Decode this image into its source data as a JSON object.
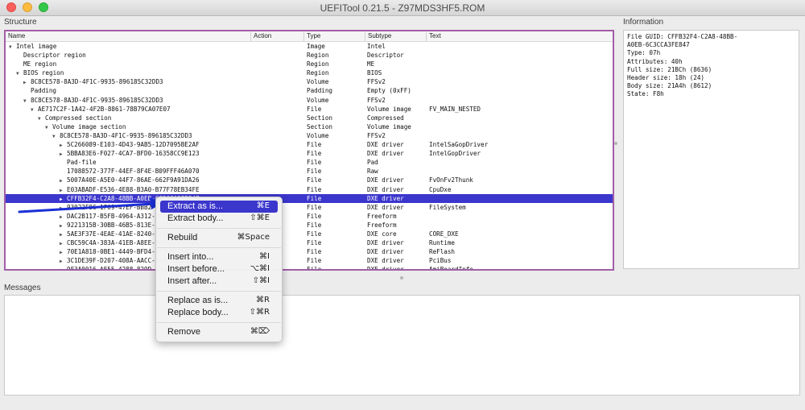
{
  "window": {
    "title": "UEFITool 0.21.5 - Z97MDS3HF5.ROM"
  },
  "panes": {
    "structure": "Structure",
    "information": "Information",
    "messages": "Messages"
  },
  "columns": {
    "name": "Name",
    "action": "Action",
    "type": "Type",
    "subtype": "Subtype",
    "text": "Text"
  },
  "rows": [
    {
      "name": "Intel image",
      "type": "Image",
      "subtype": "Intel",
      "text": "",
      "indent": 0,
      "arrow": "▼"
    },
    {
      "name": "Descriptor region",
      "type": "Region",
      "subtype": "Descriptor",
      "text": "",
      "indent": 1,
      "arrow": ""
    },
    {
      "name": "ME region",
      "type": "Region",
      "subtype": "ME",
      "text": "",
      "indent": 1,
      "arrow": ""
    },
    {
      "name": "BIOS region",
      "type": "Region",
      "subtype": "BIOS",
      "text": "",
      "indent": 1,
      "arrow": "▼"
    },
    {
      "name": "8C8CE578-8A3D-4F1C-9935-896185C32DD3",
      "type": "Volume",
      "subtype": "FFSv2",
      "text": "",
      "indent": 2,
      "arrow": "▶"
    },
    {
      "name": "Padding",
      "type": "Padding",
      "subtype": "Empty (0xFF)",
      "text": "",
      "indent": 2,
      "arrow": ""
    },
    {
      "name": "8C8CE578-8A3D-4F1C-9935-896185C32DD3",
      "type": "Volume",
      "subtype": "FFSv2",
      "text": "",
      "indent": 2,
      "arrow": "▼"
    },
    {
      "name": "AE717C2F-1A42-4F2B-8861-78B79CA07E07",
      "type": "File",
      "subtype": "Volume image",
      "text": "FV_MAIN_NESTED",
      "indent": 3,
      "arrow": "▼"
    },
    {
      "name": "Compressed section",
      "type": "Section",
      "subtype": "Compressed",
      "text": "",
      "indent": 4,
      "arrow": "▼"
    },
    {
      "name": "Volume image section",
      "type": "Section",
      "subtype": "Volume image",
      "text": "",
      "indent": 5,
      "arrow": "▼"
    },
    {
      "name": "8C8CE578-8A3D-4F1C-9935-896185C32DD3",
      "type": "Volume",
      "subtype": "FFSv2",
      "text": "",
      "indent": 6,
      "arrow": "▼"
    },
    {
      "name": "5C266089-E103-4D43-9AB5-12D7095BE2AF",
      "type": "File",
      "subtype": "DXE driver",
      "text": "IntelSaGopDriver",
      "indent": 7,
      "arrow": "▶"
    },
    {
      "name": "5BBA83E6-F027-4CA7-BFD0-16358CC9E123",
      "type": "File",
      "subtype": "DXE driver",
      "text": "IntelGopDriver",
      "indent": 7,
      "arrow": "▶"
    },
    {
      "name": "Pad-file",
      "type": "File",
      "subtype": "Pad",
      "text": "",
      "indent": 7,
      "arrow": ""
    },
    {
      "name": "17088572-377F-44EF-8F4E-B09FFF46A070",
      "type": "File",
      "subtype": "Raw",
      "text": "",
      "indent": 7,
      "arrow": ""
    },
    {
      "name": "5007A40E-A5E0-44F7-86AE-662F9A91DA26",
      "type": "File",
      "subtype": "DXE driver",
      "text": "FvOnFv2Thunk",
      "indent": 7,
      "arrow": "▶"
    },
    {
      "name": "E03ABADF-E536-4E88-B3A0-B77F78EB34FE",
      "type": "File",
      "subtype": "DXE driver",
      "text": "CpuDxe",
      "indent": 7,
      "arrow": "▶"
    },
    {
      "name": "CFFB32F4-C2A8-48BB-A0EB-6C3CCA3FE847",
      "type": "File",
      "subtype": "DXE driver",
      "text": "",
      "indent": 7,
      "arrow": "▶",
      "selected": true
    },
    {
      "name": "93022F8C-1F09-47EF-BBB2-5814FF609DF5",
      "type": "File",
      "subtype": "DXE driver",
      "text": "FileSystem",
      "indent": 7,
      "arrow": "▶"
    },
    {
      "name": "DAC2B117-B5FB-4964-A312-0DCC77061B9B",
      "type": "File",
      "subtype": "Freeform",
      "text": "",
      "indent": 7,
      "arrow": "▶"
    },
    {
      "name": "9221315B-30BB-46B5-813E-1B1BF4712BD3",
      "type": "File",
      "subtype": "Freeform",
      "text": "",
      "indent": 7,
      "arrow": "▶"
    },
    {
      "name": "5AE3F37E-4EAE-41AE-8240-35465B5E81EB",
      "type": "File",
      "subtype": "DXE core",
      "text": "CORE_DXE",
      "indent": 7,
      "arrow": "▶"
    },
    {
      "name": "CBC59C4A-383A-41EB-A8EE-4498AEA567E4",
      "type": "File",
      "subtype": "DXE driver",
      "text": "Runtime",
      "indent": 7,
      "arrow": "▶"
    },
    {
      "name": "70E1A818-0BE1-4449-BFD4-9EF68C7F02A8",
      "type": "File",
      "subtype": "DXE driver",
      "text": "ReFlash",
      "indent": 7,
      "arrow": "▶"
    },
    {
      "name": "3C1DE39F-D207-408A-AACC-731CFB7F1DD7",
      "type": "File",
      "subtype": "DXE driver",
      "text": "PciBus",
      "indent": 7,
      "arrow": "▶"
    },
    {
      "name": "9F3A0016-AE55-4288-829D-D22FD344C347",
      "type": "File",
      "subtype": "DXE driver",
      "text": "AmiBoardInfo",
      "indent": 7,
      "arrow": "▶"
    }
  ],
  "information": [
    "File GUID: CFFB32F4-C2A8-48BB-",
    "A0EB-6C3CCA3FE847",
    "Type: 07h",
    "Attributes: 40h",
    "Full size: 21BCh (8636)",
    "Header size: 18h (24)",
    "Body size: 21A4h (8612)",
    "State: F8h"
  ],
  "context_menu": {
    "items": [
      {
        "label": "Extract as is...",
        "shortcut": "⌘E",
        "active": true
      },
      {
        "label": "Extract body...",
        "shortcut": "⇧⌘E"
      },
      {
        "label": "Rebuild",
        "shortcut": "⌘Space"
      },
      {
        "label": "Insert into...",
        "shortcut": "⌘I"
      },
      {
        "label": "Insert before...",
        "shortcut": "⌥⌘I"
      },
      {
        "label": "Insert after...",
        "shortcut": "⇧⌘I"
      },
      {
        "label": "Replace as is...",
        "shortcut": "⌘R"
      },
      {
        "label": "Replace body...",
        "shortcut": "⇧⌘R"
      },
      {
        "label": "Remove",
        "shortcut": "⌘⌦"
      }
    ]
  },
  "colors": {
    "selection": "#3b36cc",
    "frame_highlight": "#a25ea8",
    "annotation_arrow": "#1a2fd6"
  }
}
